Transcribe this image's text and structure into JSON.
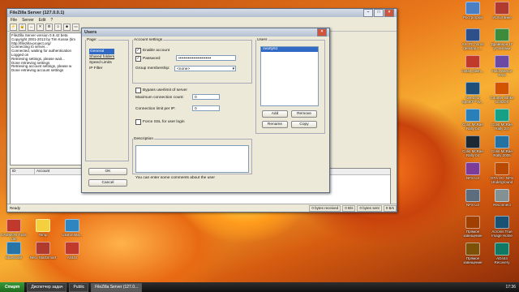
{
  "right_icons": [
    {
      "label": "Рострогрой",
      "color": "#4a7fc4"
    },
    {
      "label": "Испытание",
      "color": "#b03a2e"
    },
    {
      "label": "ASI PC home desktop 1...",
      "color": "#2d4f8a"
    },
    {
      "label": "Драйвера 1Г установки",
      "color": "#3c8c3c"
    },
    {
      "label": "install_flash...",
      "color": "#c0392b"
    },
    {
      "label": "Hold Warrior РАН",
      "color": "#6b4aa5"
    },
    {
      "label": "Need for Speed™ W...",
      "color": "#1f4e79"
    },
    {
      "label": "Counter-Strike GoltzOrf",
      "color": "#d35400"
    },
    {
      "label": "Colin McRae Rally 04",
      "color": "#2980b9"
    },
    {
      "label": "Colin McRae Rally 2.0",
      "color": "#16a085"
    },
    {
      "label": "Colin McRae Rally 04",
      "color": "#1c2833"
    },
    {
      "label": "Colin McRae Rally 2005",
      "color": "#2471a3"
    },
    {
      "label": "NFS U2",
      "color": "#7d3c98"
    },
    {
      "label": "GTA VC- NFS Underground",
      "color": "#ba4a00"
    },
    {
      "label": "NFS U2",
      "color": "#5d6d7e"
    },
    {
      "label": "Reconnect",
      "color": "#839192"
    },
    {
      "label": "Прямое извещение",
      "color": "#a04000"
    },
    {
      "label": "Acronis True Image Home",
      "color": "#1a5276"
    },
    {
      "label": "Прямое извещение",
      "color": "#7e5109"
    },
    {
      "label": "AD444 Recovery",
      "color": "#117864"
    }
  ],
  "left_icons": [
    {
      "label": "DAEMON Tools Lite",
      "color": "#c0392b"
    },
    {
      "label": "Temp",
      "color": "#f4d03f"
    },
    {
      "label": "USBVeiMa...",
      "color": "#2e86c1"
    },
    {
      "label": "BlueSoleil",
      "color": "#2874a6"
    },
    {
      "label": "Nero StartSmart",
      "color": "#b03a2e"
    },
    {
      "label": "ASUS",
      "color": "#c0392b"
    }
  ],
  "filezilla": {
    "title": "FileZilla Server (127.0.0.1)",
    "menu": [
      "File",
      "Server",
      "Edit",
      "?"
    ],
    "log": [
      "FileZilla Server version 0.9.42 beta",
      "Copyright 2001-2013 by Tim Kosse (tim",
      "http://filezilla-project.org/",
      "Connecting to server...",
      "Connected, waiting for authentication",
      "Logged on",
      "Retrieving settings, please wait...",
      "Done retrieving settings",
      "Retrieving account settings, please w",
      "Done retrieving account settings"
    ],
    "columns": [
      "ID",
      "Account"
    ],
    "status_ready": "Ready",
    "bytes_received": "0 bytes received",
    "recv_rate": "0 B/s",
    "bytes_sent": "0 bytes sent",
    "send_rate": "0 B/s"
  },
  "users_dialog": {
    "title": "Users",
    "pages_label": "Page:",
    "pages": [
      "General",
      "Shared folders",
      "Speed Limits",
      "IP Filter"
    ],
    "account_settings_label": "Account settings",
    "enable_account": "Enable account",
    "password_label": "Password:",
    "password_value": "••••••••••••••••••••••••",
    "group_label": "Group membership:",
    "group_value": "<none>",
    "bypass": "Bypass userlimit of server",
    "max_conn_label": "Maximum connection count:",
    "max_conn_value": "0",
    "conn_ip_label": "Connection limit per IP:",
    "conn_ip_value": "0",
    "force_ssl": "Force SSL for user login",
    "description_label": "Description",
    "description_hint": "You can enter some comments about the user",
    "users_label": "Users",
    "users": [
      "ovarty51"
    ],
    "add": "Add",
    "remove": "Remove",
    "rename": "Rename",
    "copy": "Copy",
    "ok": "OK",
    "cancel": "Cancel"
  },
  "taskbar": {
    "start": "Старт",
    "tasks": [
      "Диспетчер задач",
      "Public",
      "FileZilla Server (127.0..."
    ],
    "clock": "17:36"
  }
}
